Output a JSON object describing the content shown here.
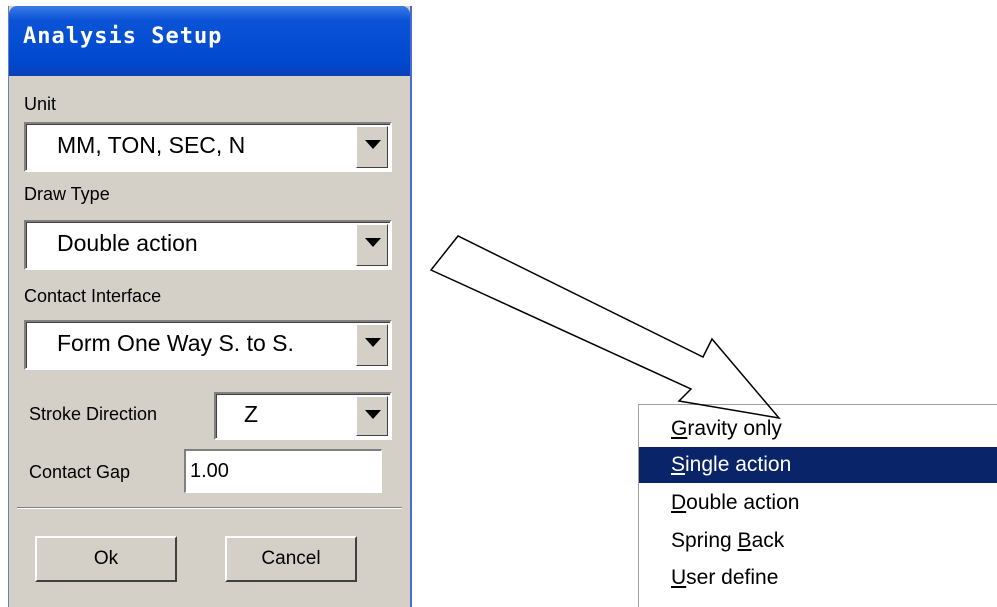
{
  "dialog": {
    "title": "Analysis Setup",
    "unit": {
      "label": "Unit",
      "value": "MM, TON, SEC, N"
    },
    "draw_type": {
      "label": "Draw Type",
      "value": "Double action"
    },
    "contact_interface": {
      "label": "Contact Interface",
      "value": "Form One Way S. to S."
    },
    "stroke_direction": {
      "label": "Stroke Direction",
      "value": "Z"
    },
    "contact_gap": {
      "label": "Contact Gap",
      "value": "1.00"
    },
    "ok_label": "Ok",
    "cancel_label": "Cancel"
  },
  "dropdown_menu": {
    "selected_index": 1,
    "items": [
      {
        "mnemonic": "G",
        "rest": "ravity only"
      },
      {
        "mnemonic": "S",
        "rest": "ingle action"
      },
      {
        "mnemonic": "D",
        "rest": "ouble action"
      },
      {
        "prefix": "Spring ",
        "mnemonic": "B",
        "rest": "ack"
      },
      {
        "mnemonic": "U",
        "rest": "ser define"
      }
    ]
  },
  "colors": {
    "title_bar": "#0049cf",
    "dialog_bg": "#d4d0c8",
    "menu_highlight": "#0a246a"
  }
}
